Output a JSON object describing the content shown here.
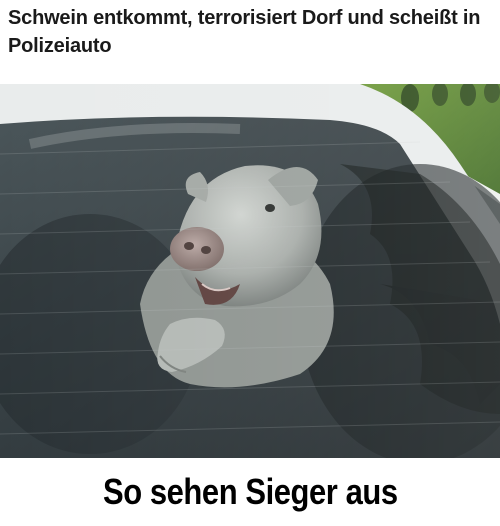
{
  "meme": {
    "headline": "Schwein entkommt, terrorisiert Dorf und scheißt in Polizeiauto",
    "caption": "So sehen Sieger aus"
  },
  "photo": {
    "subject": "pig-icon",
    "scene": "police-car-window"
  },
  "colors": {
    "background": "#ffffff",
    "text": "#1a1a1a",
    "caption_text": "#000000",
    "glass_tint": "#3a4448",
    "grass": "#4f7d2a",
    "car_roof": "#e9ecec"
  }
}
